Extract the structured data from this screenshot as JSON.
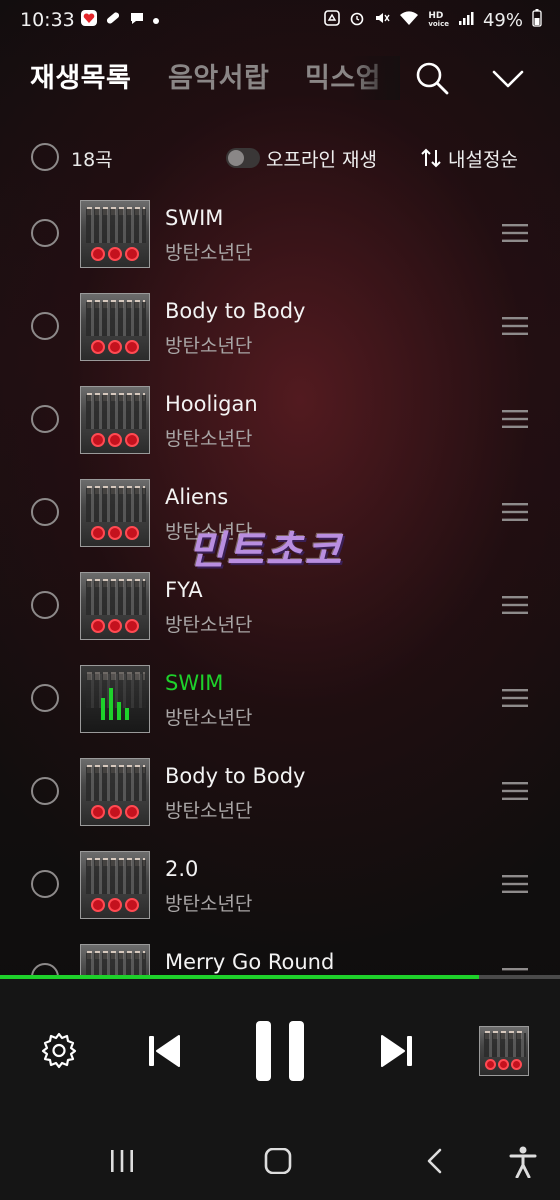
{
  "status_bar": {
    "time": "10:33",
    "hd_label": "HD",
    "voice_label": "voice",
    "battery": "49%"
  },
  "header": {
    "tabs": [
      {
        "label": "재생목록",
        "active": true
      },
      {
        "label": "음악서랍",
        "active": false
      },
      {
        "label": "믹스업",
        "active": false
      }
    ],
    "icons": [
      "search-icon",
      "chevron-down-icon"
    ]
  },
  "toolbar": {
    "count": "18곡",
    "offline_label": "오프라인 재생",
    "offline_on": false,
    "sort_label": "내설정순"
  },
  "songs": [
    {
      "title": "SWIM",
      "artist": "방탄소년단",
      "playing": false
    },
    {
      "title": "Body to Body",
      "artist": "방탄소년단",
      "playing": false
    },
    {
      "title": "Hooligan",
      "artist": "방탄소년단",
      "playing": false
    },
    {
      "title": "Aliens",
      "artist": "방탄소년단",
      "playing": false
    },
    {
      "title": "FYA",
      "artist": "방탄소년단",
      "playing": false
    },
    {
      "title": "SWIM",
      "artist": "방탄소년단",
      "playing": true
    },
    {
      "title": "Body to Body",
      "artist": "방탄소년단",
      "playing": false
    },
    {
      "title": "2.0",
      "artist": "방탄소년단",
      "playing": false
    },
    {
      "title": "Merry Go Round",
      "artist": "방탄소년단",
      "playing": false
    }
  ],
  "watermark": "민트초코",
  "player": {
    "progress": 0.855,
    "accent_color": "#1ed12b"
  },
  "colors": {
    "accent": "#1ed12b",
    "text_muted": "#a9a6a6"
  }
}
